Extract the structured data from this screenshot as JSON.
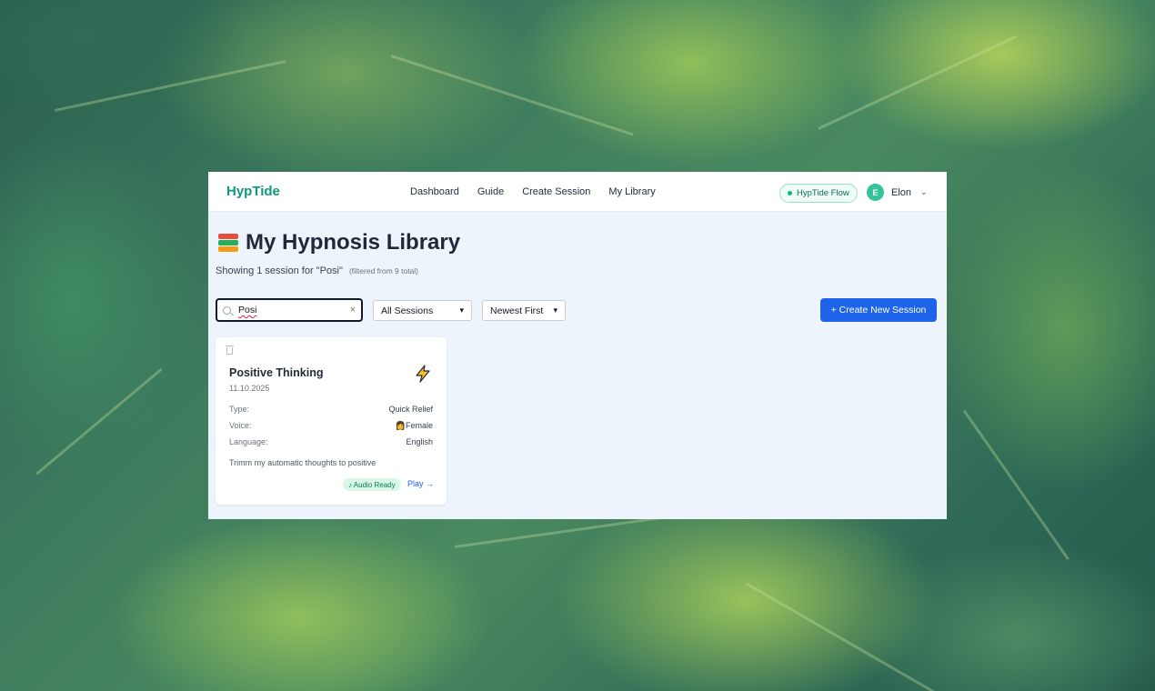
{
  "header": {
    "brand": "HypTide",
    "nav": [
      "Dashboard",
      "Guide",
      "Create Session",
      "My Library"
    ],
    "flow_pill": "HypTide Flow",
    "user_initial": "E",
    "user_name": "Elon"
  },
  "main": {
    "title": "My Hypnosis Library",
    "subtitle": "Showing 1 session for \"Posi\"",
    "subtitle_note": "(filtered from 9 total)",
    "search_value": "Posi",
    "filter_select": "All Sessions",
    "sort_select": "Newest First",
    "create_button": "+ Create New Session"
  },
  "cards": [
    {
      "title": "Positive Thinking",
      "date": "11.10.2025",
      "type_label": "Type:",
      "type_value": "Quick Relief",
      "voice_label": "Voice:",
      "voice_value": "👩Female",
      "language_label": "Language:",
      "language_value": "English",
      "description": "Trimm my automatic thoughts to positive",
      "badge": "♪ Audio Ready",
      "play_label": "Play →"
    }
  ],
  "colors": {
    "brand": "#0f9b7a",
    "primary": "#1d64e8",
    "page_bg": "#eef4fc"
  }
}
